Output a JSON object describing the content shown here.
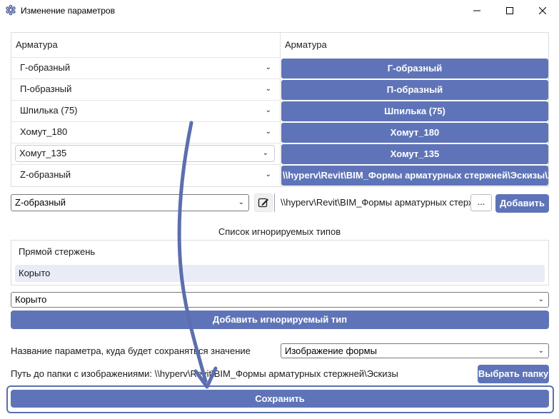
{
  "window": {
    "title": "Изменение параметров",
    "minimize_icon": "minimize-icon",
    "maximize_icon": "maximize-icon",
    "close_icon": "close-icon"
  },
  "mapping_table": {
    "left_header": "Арматура",
    "right_header": "Арматура",
    "rows": [
      {
        "type": "Г-образный",
        "value": "Г-образный"
      },
      {
        "type": "П-образный",
        "value": "П-образный"
      },
      {
        "type": "Шпилька (75)",
        "value": "Шпилька (75)"
      },
      {
        "type": "Хомут_180",
        "value": "Хомут_180"
      },
      {
        "type": "Хомут_135",
        "value": "Хомут_135"
      },
      {
        "type": "Z-образный",
        "value": "\\\\hyperv\\Revit\\BIM_Формы арматурных стержней\\Эскизы\\Z-"
      }
    ]
  },
  "add_row": {
    "type_select_value": "Z-образный",
    "edit_icon": "edit-icon",
    "path_value": "\\\\hyperv\\Revit\\BIM_Формы арматурных стерж",
    "browse_label": "...",
    "add_label": "Добавить"
  },
  "ignore": {
    "section_label": "Список игнорируемых типов",
    "items": [
      "Прямой стержень",
      "Корыто"
    ],
    "select_value": "Корыто",
    "add_label": "Добавить игнорируемый тип"
  },
  "param": {
    "label": "Название параметра, куда будет сохраняться значение",
    "select_value": "Изображение формы"
  },
  "folder": {
    "label": "Путь до папки с изображениями: \\\\hyperv\\Revit\\BIM_Формы арматурных стержней\\Эскизы",
    "button_label": "Выбрать папку"
  },
  "save_label": "Сохранить",
  "colors": {
    "accent": "#5f74b8",
    "selected_row": "#e9ecf7",
    "annotation": "#5b6fae"
  }
}
